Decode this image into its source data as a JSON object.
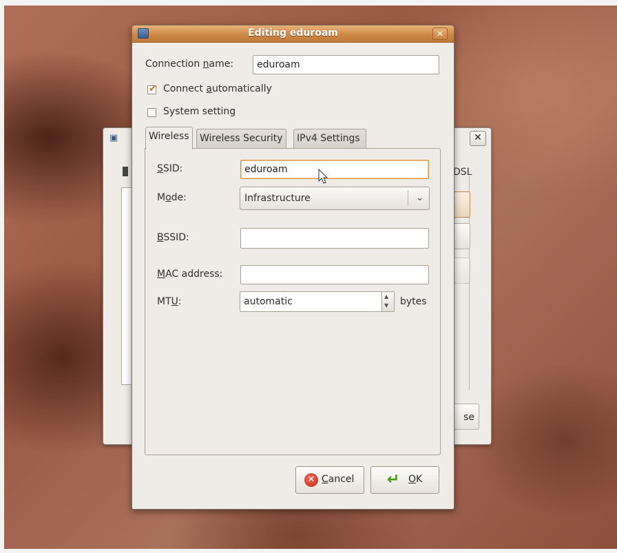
{
  "background_window": {
    "tab_label_fragment": "DSL",
    "close_button_fragment": "se",
    "close_symbol": "✕"
  },
  "dialog": {
    "title": "Editing eduroam",
    "close_symbol": "✕",
    "connection_name": {
      "label_before": "Connection ",
      "label_mnemonic": "n",
      "label_after": "ame:",
      "value": "eduroam"
    },
    "connect_automatically": {
      "label_before": "Connect ",
      "label_mnemonic": "a",
      "label_after": "utomatically",
      "checked": true
    },
    "system_setting": {
      "label": "System setting",
      "checked": false
    },
    "tabs": [
      {
        "label": "Wireless",
        "active": true
      },
      {
        "label": "Wireless Security",
        "active": false
      },
      {
        "label": "IPv4 Settings",
        "active": false
      }
    ],
    "wireless": {
      "ssid": {
        "label_mnemonic": "S",
        "label_after": "SID:",
        "value": "eduroam"
      },
      "mode": {
        "label_before": "M",
        "label_mnemonic": "o",
        "label_after": "de:",
        "value": "Infrastructure"
      },
      "bssid": {
        "label_mnemonic": "B",
        "label_after": "SSID:",
        "value": ""
      },
      "mac": {
        "label_mnemonic": "M",
        "label_after": "AC address:",
        "value": ""
      },
      "mtu": {
        "label_before": "MT",
        "label_mnemonic": "U",
        "label_after": ":",
        "value": "automatic",
        "unit": "bytes"
      }
    },
    "buttons": {
      "cancel": {
        "mnemonic": "C",
        "rest": "ancel"
      },
      "ok": {
        "mnemonic": "O",
        "rest": "K"
      }
    }
  }
}
